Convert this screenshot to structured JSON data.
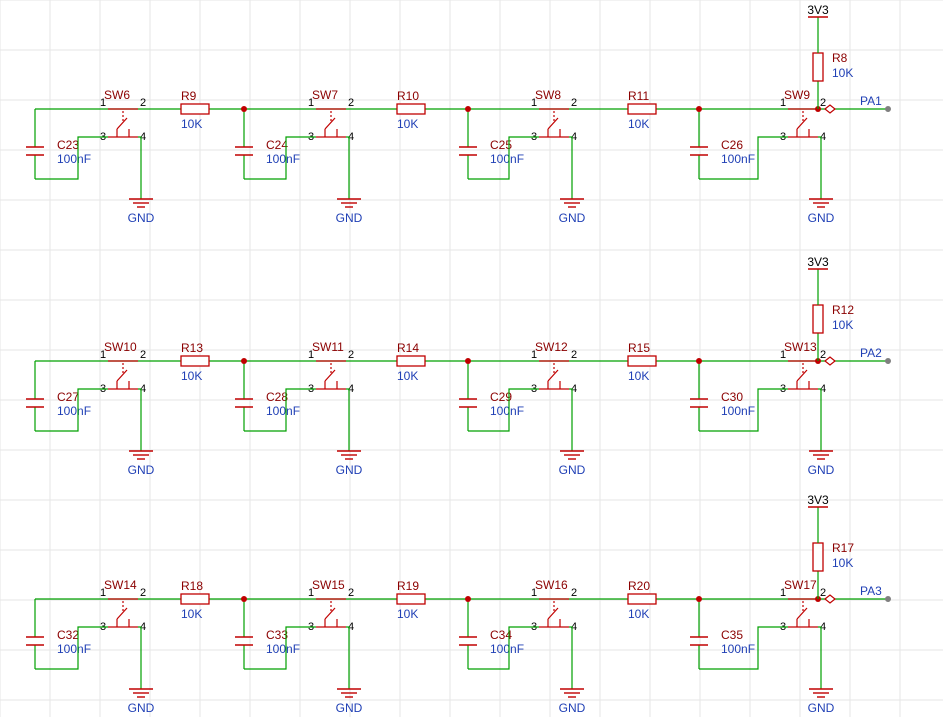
{
  "power_label": "3V3",
  "ground_label": "GND",
  "rows": [
    {
      "switches": [
        "SW6",
        "SW7",
        "SW8",
        "SW9"
      ],
      "resistors": [
        {
          "ref": "R9",
          "value": "10K"
        },
        {
          "ref": "R10",
          "value": "10K"
        },
        {
          "ref": "R11",
          "value": "10K"
        }
      ],
      "caps": [
        {
          "ref": "C23",
          "value": "100nF"
        },
        {
          "ref": "C24",
          "value": "100nF"
        },
        {
          "ref": "C25",
          "value": "100nF"
        },
        {
          "ref": "C26",
          "value": "100nF"
        }
      ],
      "pullup": {
        "ref": "R8",
        "value": "10K"
      },
      "port": "PA1",
      "power": "3V3"
    },
    {
      "switches": [
        "SW10",
        "SW11",
        "SW12",
        "SW13"
      ],
      "resistors": [
        {
          "ref": "R13",
          "value": "10K"
        },
        {
          "ref": "R14",
          "value": "10K"
        },
        {
          "ref": "R15",
          "value": "10K"
        }
      ],
      "caps": [
        {
          "ref": "C27",
          "value": "100nF"
        },
        {
          "ref": "C28",
          "value": "100nF"
        },
        {
          "ref": "C29",
          "value": "100nF"
        },
        {
          "ref": "C30",
          "value": "100nF"
        }
      ],
      "pullup": {
        "ref": "R12",
        "value": "10K"
      },
      "port": "PA2",
      "power": "3V3"
    },
    {
      "switches": [
        "SW14",
        "SW15",
        "SW16",
        "SW17"
      ],
      "resistors": [
        {
          "ref": "R18",
          "value": "10K"
        },
        {
          "ref": "R19",
          "value": "10K"
        },
        {
          "ref": "R20",
          "value": "10K"
        }
      ],
      "caps": [
        {
          "ref": "C32",
          "value": "100nF"
        },
        {
          "ref": "C33",
          "value": "100nF"
        },
        {
          "ref": "C34",
          "value": "100nF"
        },
        {
          "ref": "C35",
          "value": "100nF"
        }
      ],
      "pullup": {
        "ref": "R17",
        "value": "10K"
      },
      "port": "PA3",
      "power": "3V3"
    }
  ],
  "pins": {
    "p1": "1",
    "p2": "2",
    "p3": "3",
    "p4": "4"
  },
  "colors": {
    "wire": "#00a000",
    "symbol": "#c00000",
    "ref_text": "#8b0000",
    "value_text": "#1f3fb5",
    "grid": "#e6e6e6",
    "port": "#808080"
  }
}
